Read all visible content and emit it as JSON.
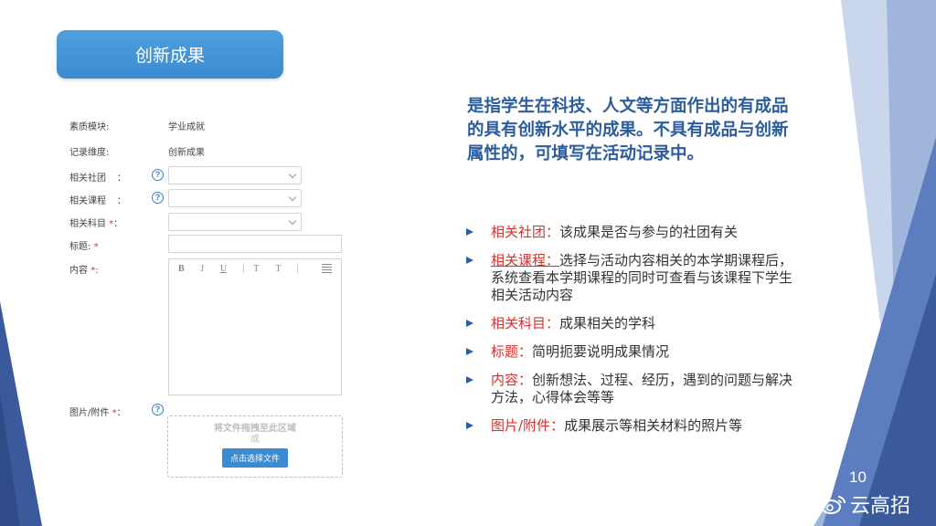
{
  "title": "创新成果",
  "form": {
    "rows": [
      {
        "label": "素质模块:",
        "value": "学业成就"
      },
      {
        "label": "记录维度:",
        "value": "创新成果"
      }
    ],
    "club_label": "相关社团",
    "club_colon": "：",
    "course_label": "相关课程",
    "course_colon": "：",
    "subject_label": "相关科目",
    "subject_colon": "：",
    "title_label": "标题:",
    "content_label": "内容",
    "content_colon": ":",
    "attach_label": "图片/附件",
    "attach_colon": "：",
    "star": "*",
    "help": "?",
    "toolbar": {
      "bold": "B",
      "italic": "I",
      "underline": "U",
      "t1": "T",
      "t2": "T"
    },
    "upload": {
      "drop": "将文件拖拽至此区域",
      "or": "或",
      "button": "点击选择文件"
    }
  },
  "description": "是指学生在科技、人文等方面作出的有成品的具有创新水平的成果。不具有成品与创新属性的，可填写在活动记录中。",
  "bullets": [
    {
      "key": "相关社团",
      "sep": "：",
      "text": "该成果是否与参与的社团有关"
    },
    {
      "key": "相关课程",
      "sep": "：",
      "text": "选择与活动内容相关的本学期课程后，系统查看本学期课程的同时可查看与该课程下学生相关活动内容"
    },
    {
      "key": "相关科目",
      "sep": "：",
      "text": "成果相关的学科"
    },
    {
      "key": "标题",
      "sep": "：",
      "text": "简明扼要说明成果情况"
    },
    {
      "key": "内容",
      "sep": "：",
      "text": "创新想法、过程、经历，遇到的问题与解决方法，心得体会等等"
    },
    {
      "key": "图片/附件",
      "sep": "：",
      "text": "成果展示等相关材料的照片等"
    }
  ],
  "page_number": "10",
  "watermark": "云高招",
  "icons": {
    "help": "help-circle-icon",
    "dropdown": "chevron-down-icon",
    "arrow": "triangle-right-icon",
    "weibo": "weibo-icon"
  },
  "colors": {
    "accent": "#3b8bd2",
    "deco_blue": "#3a5a9c",
    "required": "#d9302c",
    "heading_text": "#2c5d9c"
  }
}
